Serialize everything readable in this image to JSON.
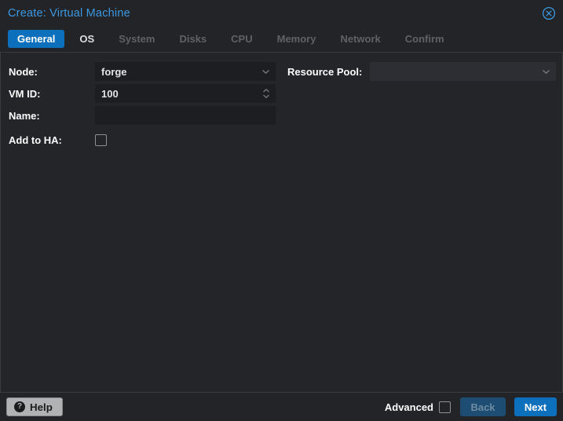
{
  "dialog": {
    "title": "Create: Virtual Machine"
  },
  "tabs": [
    {
      "label": "General",
      "state": "active"
    },
    {
      "label": "OS",
      "state": "enabled"
    },
    {
      "label": "System",
      "state": "disabled"
    },
    {
      "label": "Disks",
      "state": "disabled"
    },
    {
      "label": "CPU",
      "state": "disabled"
    },
    {
      "label": "Memory",
      "state": "disabled"
    },
    {
      "label": "Network",
      "state": "disabled"
    },
    {
      "label": "Confirm",
      "state": "disabled"
    }
  ],
  "form": {
    "node": {
      "label": "Node:",
      "value": "forge"
    },
    "vmid": {
      "label": "VM ID:",
      "value": "100"
    },
    "name": {
      "label": "Name:",
      "value": ""
    },
    "add_to_ha": {
      "label": "Add to HA:",
      "checked": false
    },
    "resource_pool": {
      "label": "Resource Pool:",
      "value": ""
    }
  },
  "footer": {
    "help": "Help",
    "help_icon_glyph": "?",
    "advanced": "Advanced",
    "advanced_checked": false,
    "back": "Back",
    "next": "Next"
  },
  "icons": {
    "close": "circle-x-icon",
    "help": "question-circle-icon",
    "combo_trigger": "chevron-down-icon",
    "vmid_trigger": "up-down-spinner-icon"
  },
  "colors": {
    "title_accent": "#3c98e0",
    "active_tab_bg": "#0d70bd",
    "next_button_bg": "#0d70bd",
    "back_button_bg": "#1d4d72",
    "field_bg": "#1c1e22",
    "resource_pool_field_bg": "#2c2e33",
    "help_button_bg": "#b1b2b3",
    "panel_border": "#393b40"
  }
}
